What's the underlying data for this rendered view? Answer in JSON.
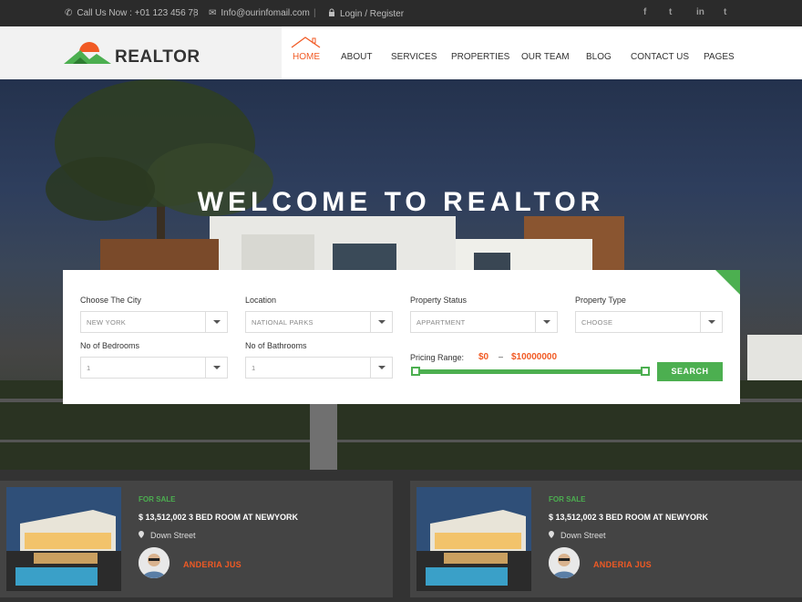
{
  "topbar": {
    "phone": "Call Us Now : +01 123 456 78",
    "email": "Info@ourinfomail.com",
    "login": "Login / Register",
    "social": [
      {
        "icon": "facebook-icon",
        "glyph": "f"
      },
      {
        "icon": "twitter-icon",
        "glyph": "t"
      },
      {
        "icon": "linkedin-icon",
        "glyph": "in"
      },
      {
        "icon": "tumblr-icon",
        "glyph": "t"
      }
    ]
  },
  "header": {
    "logo_text": "REALTOR",
    "nav": [
      "HOME",
      "ABOUT",
      "SERVICES",
      "PROPERTIES",
      "OUR TEAM",
      "BLOG",
      "CONTACT US",
      "PAGES"
    ],
    "active": "HOME"
  },
  "hero": {
    "title": "WELCOME TO REALTOR"
  },
  "search": {
    "city": {
      "label": "Choose The City",
      "value": "NEW YORK"
    },
    "location": {
      "label": "Location",
      "value": "NATIONAL PARKS"
    },
    "status": {
      "label": "Property Status",
      "value": "APPARTMENT"
    },
    "type": {
      "label": "Property Type",
      "value": "CHOOSE"
    },
    "bedrooms": {
      "label": "No of Bedrooms",
      "value": "1"
    },
    "bathrooms": {
      "label": "No of Bathrooms",
      "value": "1"
    },
    "pricing_label": "Pricing Range:",
    "price_min": "$0",
    "price_dash": "–",
    "price_max": "$10000000",
    "button": "SEARCH"
  },
  "listings": [
    {
      "status": "FOR SALE",
      "title": "$ 13,512,002 3 BED ROOM AT NEWYORK",
      "location": "Down Street",
      "agent": "ANDERIA JUS"
    },
    {
      "status": "FOR SALE",
      "title": "$ 13,512,002 3 BED ROOM AT NEWYORK",
      "location": "Down Street",
      "agent": "ANDERIA JUS"
    }
  ],
  "colors": {
    "accent": "#f15a24",
    "green": "#4caf50",
    "topbar": "#2b2b2b"
  }
}
